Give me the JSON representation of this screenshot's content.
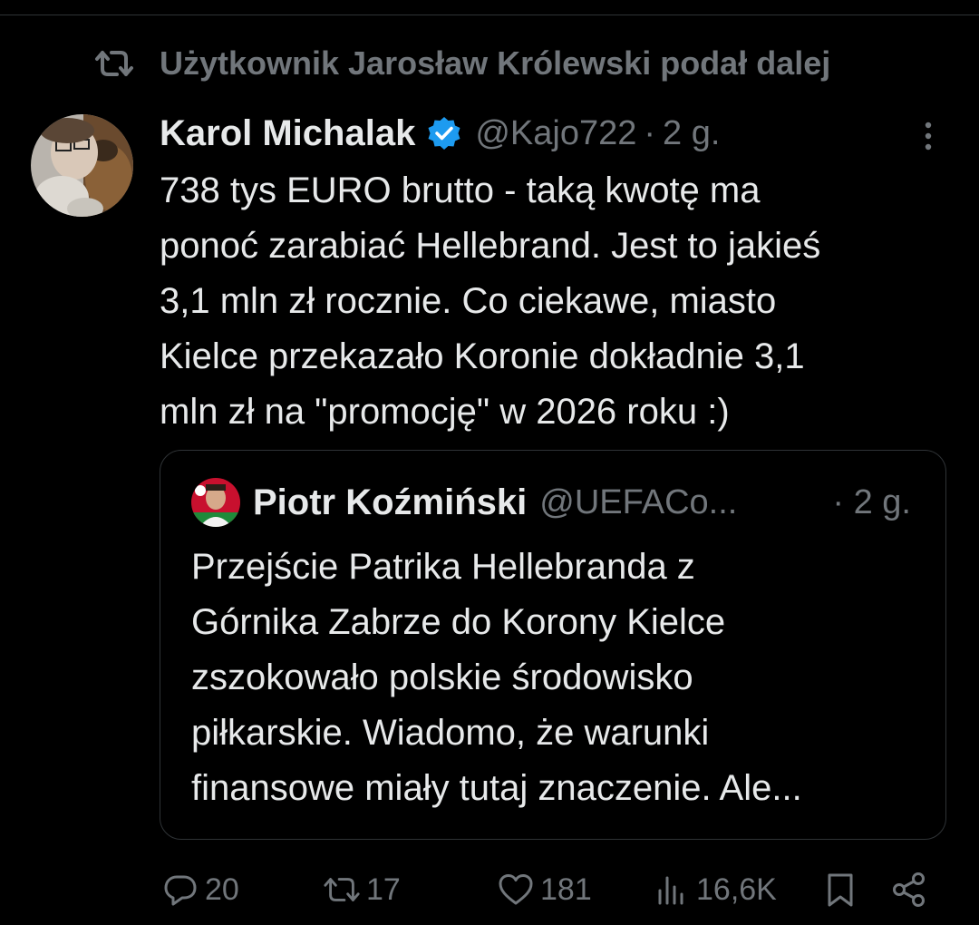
{
  "repost": {
    "label": "Użytkownik Jarosław Królewski podał dalej"
  },
  "tweet": {
    "author_name": "Karol Michalak",
    "handle": "@Kajo722",
    "separator": "·",
    "time": "2 g.",
    "lines": [
      "738 tys EURO brutto - taką kwotę ma",
      "ponoć zarabiać Hellebrand. Jest to jakieś",
      "3,1 mln zł rocznie. Co ciekawe, miasto",
      "Kielce przekazało Koronie dokładnie 3,1",
      "mln zł na \"promocję\" w 2026 roku :)"
    ]
  },
  "quote": {
    "author_name": "Piotr Koźmiński",
    "handle": "@UEFACo...",
    "time": "· 2 g.",
    "lines": [
      "Przejście Patrika Hellebranda z",
      "Górnika Zabrze do Korony Kielce",
      "zszokowało polskie środowisko",
      "piłkarskie. Wiadomo, że warunki",
      "finansowe miały tutaj znaczenie. Ale..."
    ]
  },
  "actions": {
    "replies": "20",
    "reposts": "17",
    "likes": "181",
    "views": "16,6K"
  },
  "colors": {
    "background": "#000000",
    "text": "#e7e9ea",
    "muted": "#71767b",
    "verified": "#1d9bf0",
    "border": "#2f3336"
  },
  "icons": {
    "repost": "repost-icon",
    "verified": "verified-badge-icon",
    "more": "more-vertical-icon",
    "reply": "reply-icon",
    "like": "heart-icon",
    "views": "views-icon",
    "bookmark": "bookmark-icon",
    "share": "share-icon"
  }
}
